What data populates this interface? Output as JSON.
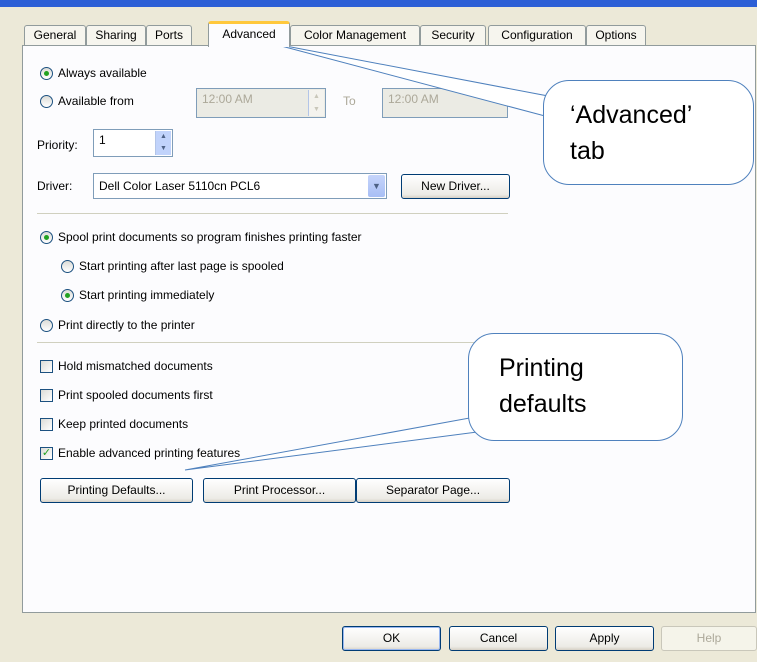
{
  "tabs": [
    "General",
    "Sharing",
    "Ports",
    "Advanced",
    "Color Management",
    "Security",
    "Configuration",
    "Options"
  ],
  "active_tab": "Advanced",
  "availability": {
    "always_label": "Always available",
    "from_label": "Available from",
    "from_time": "12:00 AM",
    "to_label": "To",
    "to_time": "12:00 AM",
    "selected": "always"
  },
  "priority": {
    "label": "Priority:",
    "value": "1"
  },
  "driver": {
    "label": "Driver:",
    "value": "Dell Color Laser 5110cn PCL6",
    "new_button": "New Driver..."
  },
  "spool": {
    "spool_label": "Spool print documents so program finishes printing faster",
    "after_last_label": "Start printing after last page is spooled",
    "immediately_label": "Start printing immediately",
    "direct_label": "Print directly to the printer"
  },
  "options": [
    {
      "label": "Hold mismatched documents",
      "checked": false
    },
    {
      "label": "Print spooled documents first",
      "checked": false
    },
    {
      "label": "Keep printed documents",
      "checked": false
    },
    {
      "label": "Enable advanced printing features",
      "checked": true
    }
  ],
  "action_buttons": [
    "Printing Defaults...",
    "Print Processor...",
    "Separator Page..."
  ],
  "dialog_buttons": {
    "ok": "OK",
    "cancel": "Cancel",
    "apply": "Apply",
    "help": "Help"
  },
  "callouts": {
    "advanced_tab": [
      "‘Advanced’",
      "tab"
    ],
    "printing_defaults": [
      "Printing",
      "defaults"
    ]
  },
  "colors": {
    "callout_border": "#4f81bd",
    "title_bar": "#2c5fd6",
    "active_tab_highlight": "#ffc83c"
  }
}
